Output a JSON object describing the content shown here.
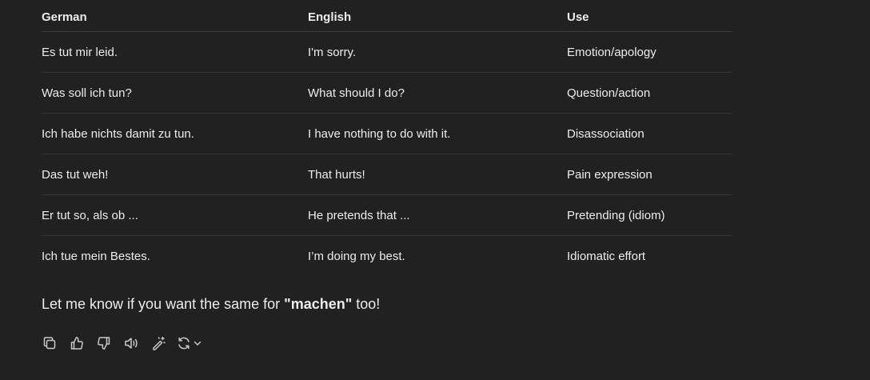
{
  "table": {
    "headers": [
      "German",
      "English",
      "Use"
    ],
    "rows": [
      [
        "Es tut mir leid.",
        "I'm sorry.",
        "Emotion/apology"
      ],
      [
        "Was soll ich tun?",
        "What should I do?",
        "Question/action"
      ],
      [
        "Ich habe nichts damit zu tun.",
        "I have nothing to do with it.",
        "Disassociation"
      ],
      [
        "Das tut weh!",
        "That hurts!",
        "Pain expression"
      ],
      [
        "Er tut so, als ob ...",
        "He pretends that ...",
        "Pretending (idiom)"
      ],
      [
        "Ich tue mein Bestes.",
        "I’m doing my best.",
        "Idiomatic effort"
      ]
    ]
  },
  "closing": {
    "prefix": "Let me know if you want the same for ",
    "bold": "\"machen\"",
    "suffix": " too!"
  },
  "actions": [
    {
      "icon": "copy-icon"
    },
    {
      "icon": "thumbs-up-icon"
    },
    {
      "icon": "thumbs-down-icon"
    },
    {
      "icon": "read-aloud-icon"
    },
    {
      "icon": "edit-magic-icon"
    },
    {
      "icon": "regenerate-icon"
    }
  ],
  "colors": {
    "background": "#212121",
    "text": "#ececec",
    "divider": "#333333",
    "icon": "#c9c9c9"
  }
}
